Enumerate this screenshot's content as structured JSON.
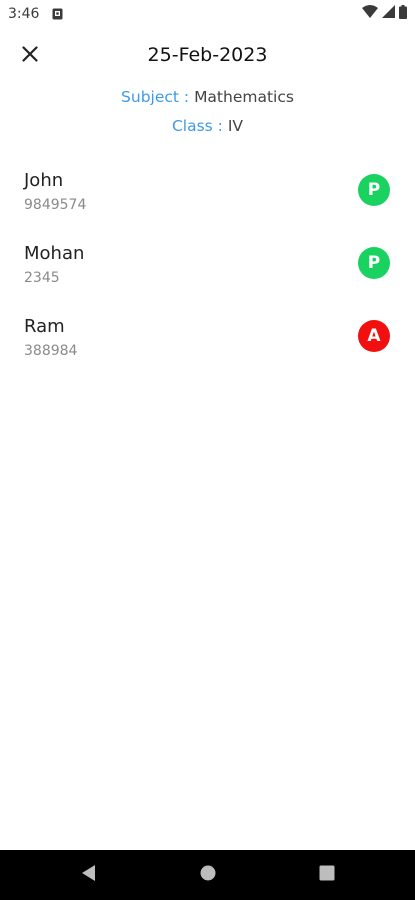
{
  "status_bar": {
    "time": "3:46",
    "notification_icon": "notification-icon",
    "wifi_icon": "wifi-icon",
    "signal_icon": "signal-icon",
    "battery_icon": "battery-icon"
  },
  "header": {
    "close_icon": "close-icon",
    "title": "25-Feb-2023"
  },
  "meta": {
    "subject_label": "Subject :",
    "subject_value": "Mathematics",
    "class_label": "Class :",
    "class_value": "IV"
  },
  "students": [
    {
      "name": "John",
      "id": "9849574",
      "status": "P",
      "status_color": "#19d25f"
    },
    {
      "name": "Mohan",
      "id": "2345",
      "status": "P",
      "status_color": "#19d25f"
    },
    {
      "name": "Ram",
      "id": "388984",
      "status": "A",
      "status_color": "#f20f0f"
    }
  ],
  "colors": {
    "accent": "#3d9ae8",
    "present": "#19d25f",
    "absent": "#f20f0f"
  },
  "nav_bar": {
    "back_icon": "back-icon",
    "home_icon": "home-icon",
    "recents_icon": "recents-icon"
  }
}
